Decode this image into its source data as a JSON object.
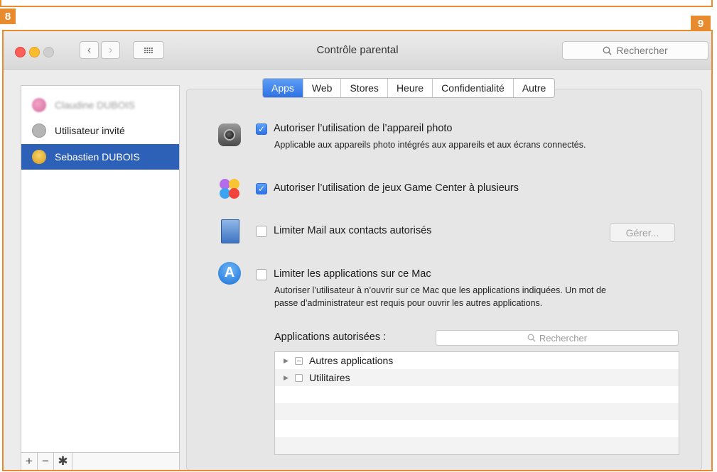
{
  "badges": {
    "left": "8",
    "right": "9"
  },
  "window": {
    "title": "Contrôle parental"
  },
  "search": {
    "placeholder": "Rechercher"
  },
  "sidebar": {
    "users": [
      {
        "name": "Claudine DUBOIS"
      },
      {
        "name": "Utilisateur invité"
      },
      {
        "name": "Sebastien DUBOIS"
      }
    ],
    "footer": {
      "add": "+",
      "remove": "−",
      "settings": "✱"
    }
  },
  "tabs": [
    "Apps",
    "Web",
    "Stores",
    "Heure",
    "Confidentialité",
    "Autre"
  ],
  "options": {
    "camera": {
      "label": "Autoriser l’utilisation de l’appareil photo",
      "desc": "Applicable aux appareils photo intégrés aux appareils et aux écrans connectés.",
      "checked": true
    },
    "gamecenter": {
      "label": "Autoriser l’utilisation de jeux Game Center à plusieurs",
      "checked": true
    },
    "mail": {
      "label": "Limiter Mail aux contacts autorisés",
      "checked": false,
      "button": "Gérer..."
    },
    "apps": {
      "label": "Limiter les applications sur ce Mac",
      "desc1": "Autoriser l’utilisateur à n’ouvrir sur ce Mac que les applications indiquées. Un mot de",
      "desc2": "passe d’administrateur est requis pour ouvrir les autres applications.",
      "checked": false
    }
  },
  "allowed": {
    "label": "Applications autorisées :",
    "search_placeholder": "Rechercher",
    "items": [
      "Autres applications",
      "Utilitaires"
    ]
  },
  "colors": {
    "accent": "#e88b2e",
    "selection": "#2d61b8"
  }
}
